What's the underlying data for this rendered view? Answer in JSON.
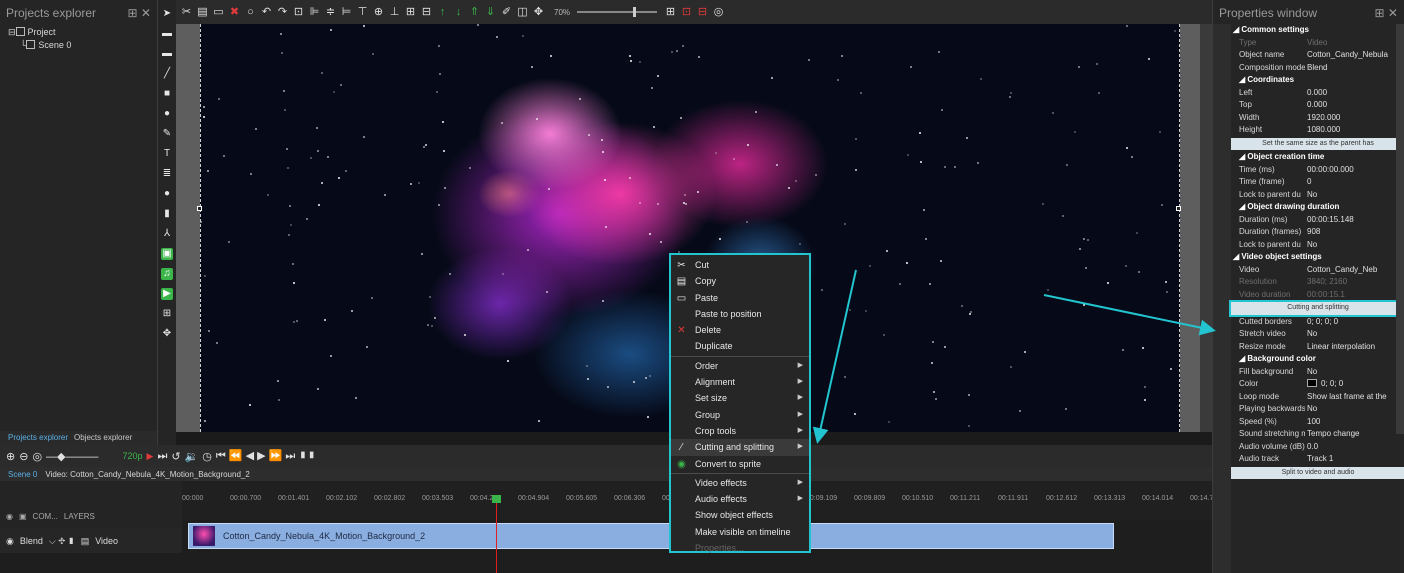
{
  "projects_explorer": {
    "title": "Projects explorer",
    "pin": "⊞ ✕",
    "tree": [
      "Project",
      "Scene 0"
    ],
    "tabs": [
      "Projects explorer",
      "Objects explorer"
    ]
  },
  "toolbar": {
    "zoom": "70%"
  },
  "playbar": {
    "quality": "720p"
  },
  "timeline": {
    "tabs": [
      "Scene 0",
      "Video: Cotton_Candy_Nebula_4K_Motion_Background_2"
    ],
    "ruler": [
      "00:000",
      "00:00.700",
      "00:01.401",
      "00:02.102",
      "00:02.802",
      "00:03.503",
      "00:04.204",
      "00:04.904",
      "00:05.605",
      "00:06.306",
      "00:07.007",
      "00:07.707",
      "00:08.408",
      "00:09.109",
      "00:09.809",
      "00:10.510",
      "00:11.211",
      "00:11.911",
      "00:12.612",
      "00:13.313",
      "00:14.014",
      "00:14.714",
      "00:15.415",
      "00:16.116"
    ],
    "row_top": {
      "com": "COM...",
      "layers": "LAYERS"
    },
    "row": {
      "blend": "Blend",
      "type": "Video"
    },
    "clip_label": "Cotton_Candy_Nebula_4K_Motion_Background_2"
  },
  "context_menu": {
    "items": [
      {
        "label": "Cut",
        "icon": "scissors-icon",
        "glyph": "✂"
      },
      {
        "label": "Copy",
        "icon": "copy-icon",
        "glyph": "▤"
      },
      {
        "label": "Paste",
        "icon": "paste-icon",
        "glyph": "▭"
      },
      {
        "label": "Paste to position",
        "icon": "",
        "glyph": ""
      },
      {
        "label": "Delete",
        "icon": "delete-icon",
        "glyph": "✕"
      },
      {
        "label": "Duplicate",
        "icon": "",
        "glyph": ""
      },
      {
        "label": "Order",
        "submenu": true
      },
      {
        "label": "Alignment",
        "submenu": true
      },
      {
        "label": "Set size",
        "submenu": true
      },
      {
        "label": "Group",
        "submenu": true
      },
      {
        "label": "Crop tools",
        "submenu": true
      },
      {
        "label": "Cutting and splitting",
        "icon": "knife-icon",
        "glyph": "⁄",
        "submenu": true,
        "selected": true
      },
      {
        "label": "Convert to sprite",
        "icon": "sprite-icon",
        "glyph": "◉"
      },
      {
        "label": "Video effects",
        "submenu": true
      },
      {
        "label": "Audio effects",
        "submenu": true
      },
      {
        "label": "Show object effects"
      },
      {
        "label": "Make visible on timeline"
      },
      {
        "label": "Properties...",
        "disabled": true
      }
    ]
  },
  "properties": {
    "title": "Properties window",
    "pin": "⊞ ✕",
    "rows": [
      {
        "kind": "sec",
        "label": "◢ Common settings"
      },
      {
        "kind": "kv",
        "k": "Type",
        "v": "Video",
        "dim": true
      },
      {
        "kind": "kv",
        "k": "Object name",
        "v": "Cotton_Candy_Nebula"
      },
      {
        "kind": "kv",
        "k": "Composition mode",
        "v": "Blend"
      },
      {
        "kind": "sub",
        "label": "◢ Coordinates"
      },
      {
        "kind": "kv",
        "k": "Left",
        "v": "0.000"
      },
      {
        "kind": "kv",
        "k": "Top",
        "v": "0.000"
      },
      {
        "kind": "kv",
        "k": "Width",
        "v": "1920.000"
      },
      {
        "kind": "kv",
        "k": "Height",
        "v": "1080.000"
      },
      {
        "kind": "btn",
        "label": "Set the same size as the parent has"
      },
      {
        "kind": "sub",
        "label": "◢ Object creation time"
      },
      {
        "kind": "kv",
        "k": "Time (ms)",
        "v": "00:00:00.000"
      },
      {
        "kind": "kv",
        "k": "Time (frame)",
        "v": "0"
      },
      {
        "kind": "kv",
        "k": "Lock to parent du",
        "v": "No"
      },
      {
        "kind": "sub",
        "label": "◢ Object drawing duration"
      },
      {
        "kind": "kv",
        "k": "Duration (ms)",
        "v": "00:00:15.148"
      },
      {
        "kind": "kv",
        "k": "Duration (frames)",
        "v": "908"
      },
      {
        "kind": "kv",
        "k": "Lock to parent du",
        "v": "No"
      },
      {
        "kind": "sec",
        "label": "◢ Video object settings"
      },
      {
        "kind": "kv",
        "k": "Video",
        "v": "Cotton_Candy_Neb"
      },
      {
        "kind": "kv",
        "k": "Resolution",
        "v": "3840; 2160",
        "dim": true
      },
      {
        "kind": "kv",
        "k": "Video duration",
        "v": "00:00:15.1",
        "dim": true
      },
      {
        "kind": "btn",
        "label": "Cutting and splitting",
        "hl": true
      },
      {
        "kind": "kv",
        "k": "Cutted borders",
        "v": "0; 0; 0; 0"
      },
      {
        "kind": "kv",
        "k": "Stretch video",
        "v": "No"
      },
      {
        "kind": "kv",
        "k": "Resize mode",
        "v": "Linear interpolation"
      },
      {
        "kind": "sub",
        "label": "◢ Background color"
      },
      {
        "kind": "kv",
        "k": "Fill background",
        "v": "No"
      },
      {
        "kind": "kv",
        "k": "Color",
        "v": "0; 0; 0",
        "swatch": true
      },
      {
        "kind": "kv",
        "k": "Loop mode",
        "v": "Show last frame at the"
      },
      {
        "kind": "kv",
        "k": "Playing backwards",
        "v": "No"
      },
      {
        "kind": "kv",
        "k": "Speed (%)",
        "v": "100"
      },
      {
        "kind": "kv",
        "k": "Sound stretching mo",
        "v": "Tempo change"
      },
      {
        "kind": "kv",
        "k": "Audio volume (dB)",
        "v": "0.0"
      },
      {
        "kind": "kv",
        "k": "Audio track",
        "v": "Track 1"
      },
      {
        "kind": "btn",
        "label": "Split to video and audio"
      }
    ]
  },
  "colors": {
    "accent": "#22c4cf",
    "clip": "#8aaee0",
    "playhead": "#e02020",
    "green": "#3bb54a"
  }
}
